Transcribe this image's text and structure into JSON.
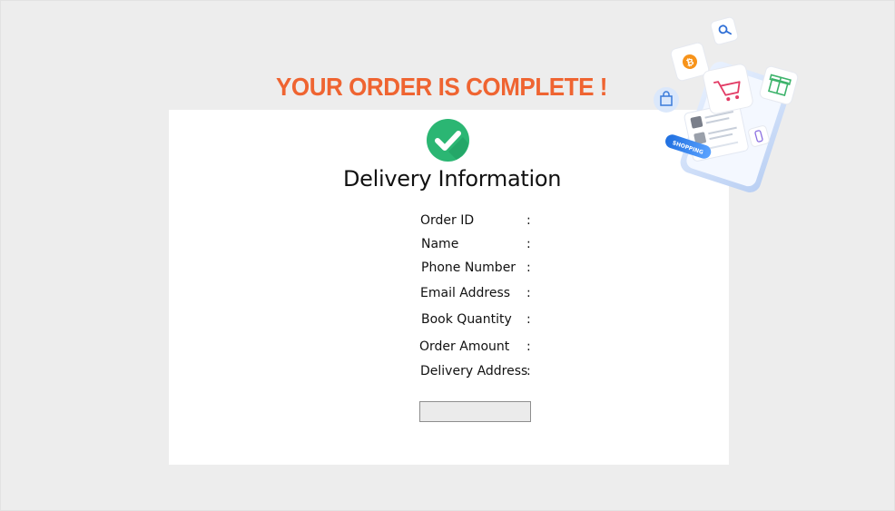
{
  "header": {
    "headline": "YOUR ORDER IS COMPLETE !"
  },
  "card": {
    "title": "Delivery Information",
    "fields": [
      {
        "label": "Order ID",
        "value": ""
      },
      {
        "label": "Name",
        "value": ""
      },
      {
        "label": "Phone Number",
        "value": ""
      },
      {
        "label": "Email Address",
        "value": ""
      },
      {
        "label": "Book Quantity",
        "value": ""
      },
      {
        "label": "Order Amount",
        "value": ""
      },
      {
        "label": "Delivery Address",
        "value": ""
      }
    ],
    "separator": ":",
    "action_button_label": ""
  },
  "illustration": {
    "badge_text": "SHOPPING",
    "icons": [
      "search-icon",
      "bitcoin-icon",
      "shopping-cart-icon",
      "gift-icon",
      "shopping-bag-icon",
      "bottle-icon"
    ]
  },
  "colors": {
    "headline": "#ef6431",
    "check_green": "#2bb673",
    "background": "#ededed",
    "card": "#ffffff"
  }
}
